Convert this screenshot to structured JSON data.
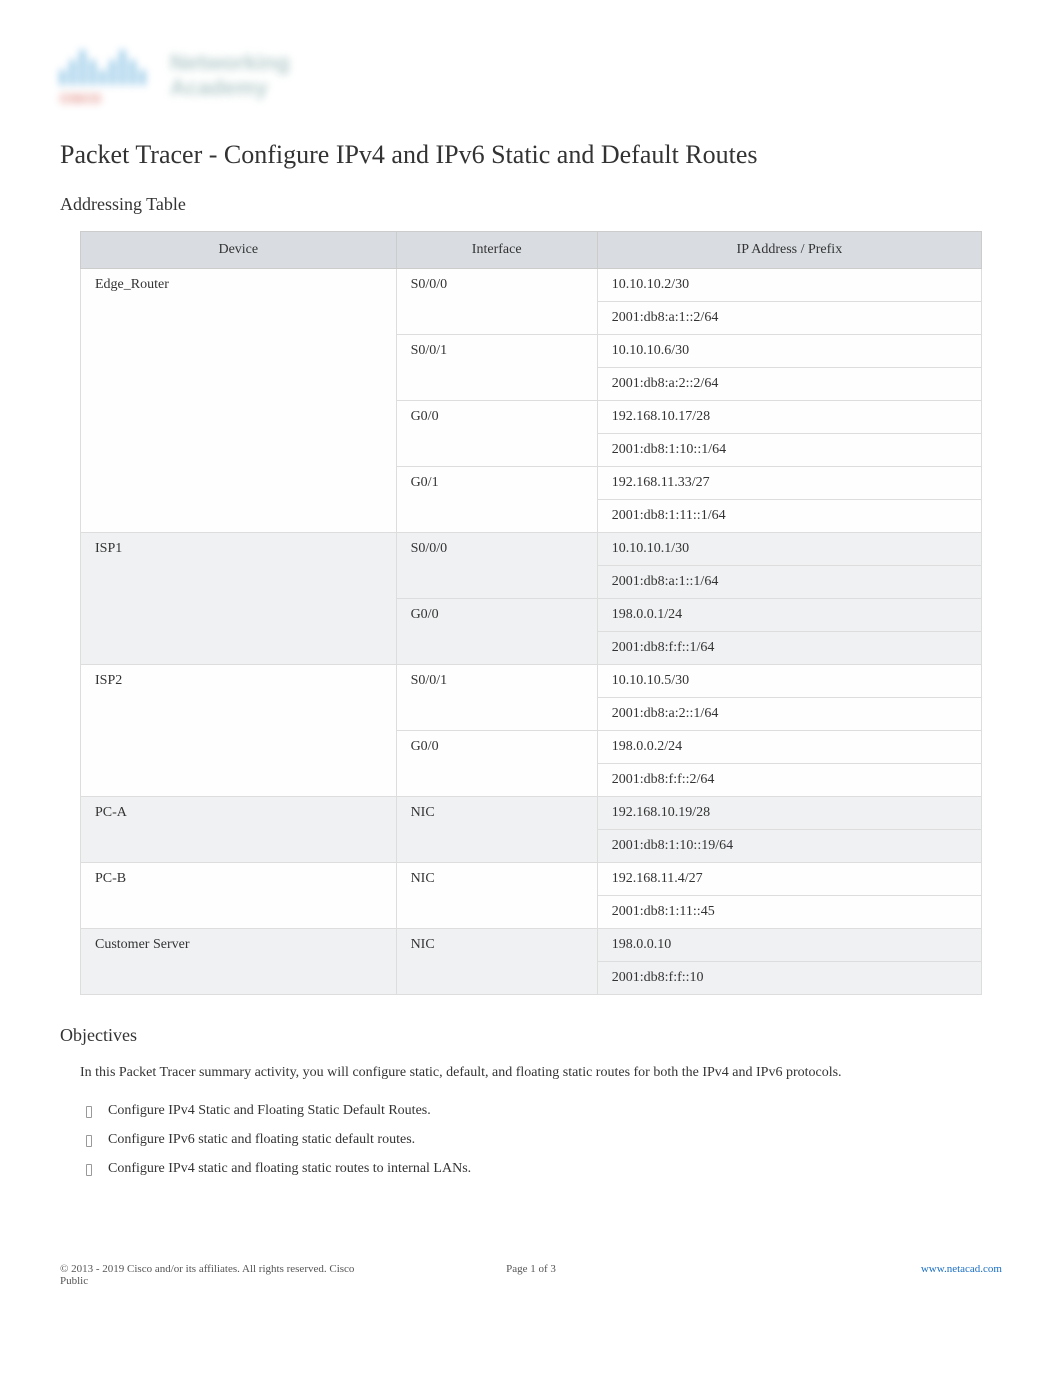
{
  "title": "Packet Tracer - Configure IPv4 and IPv6 Static and Default Routes",
  "section_addressing": "Addressing Table",
  "table": {
    "headers": [
      "Device",
      "Interface",
      "IP Address / Prefix"
    ],
    "rows": [
      {
        "device": "Edge_Router",
        "iface": "S0/0/0",
        "addrs": [
          "10.10.10.2/30",
          "2001:db8:a:1::2/64"
        ]
      },
      {
        "device": "",
        "iface": "S0/0/1",
        "addrs": [
          "10.10.10.6/30",
          "2001:db8:a:2::2/64"
        ]
      },
      {
        "device": "",
        "iface": "G0/0",
        "addrs": [
          "192.168.10.17/28",
          "2001:db8:1:10::1/64"
        ]
      },
      {
        "device": "",
        "iface": "G0/1",
        "addrs": [
          "192.168.11.33/27",
          "2001:db8:1:11::1/64"
        ]
      },
      {
        "device": "ISP1",
        "iface": "S0/0/0",
        "addrs": [
          "10.10.10.1/30",
          "2001:db8:a:1::1/64"
        ]
      },
      {
        "device": "",
        "iface": "G0/0",
        "addrs": [
          "198.0.0.1/24",
          "2001:db8:f:f::1/64"
        ]
      },
      {
        "device": "ISP2",
        "iface": "S0/0/1",
        "addrs": [
          "10.10.10.5/30",
          "2001:db8:a:2::1/64"
        ]
      },
      {
        "device": "",
        "iface": "G0/0",
        "addrs": [
          "198.0.0.2/24",
          "2001:db8:f:f::2/64"
        ]
      },
      {
        "device": "PC-A",
        "iface": "NIC",
        "addrs": [
          "192.168.10.19/28",
          "2001:db8:1:10::19/64"
        ]
      },
      {
        "device": "PC-B",
        "iface": "NIC",
        "addrs": [
          "192.168.11.4/27",
          "2001:db8:1:11::45"
        ]
      },
      {
        "device": "Customer Server",
        "iface": "NIC",
        "addrs": [
          "198.0.0.10",
          "2001:db8:f:f::10"
        ]
      }
    ]
  },
  "section_objectives": "Objectives",
  "objectives_intro": "In this Packet Tracer summary activity, you will configure static, default, and floating static routes for both the IPv4 and IPv6 protocols.",
  "objectives": [
    "Configure IPv4 Static and Floating Static Default Routes.",
    "Configure IPv6 static and floating static default routes.",
    "Configure IPv4 static and floating static routes to internal LANs."
  ],
  "footer": {
    "copyright": "© 2013 - 2019 Cisco and/or its affiliates. All rights reserved. Cisco Public",
    "page": "Page 1   of 3",
    "link": "www.netacad.com"
  }
}
